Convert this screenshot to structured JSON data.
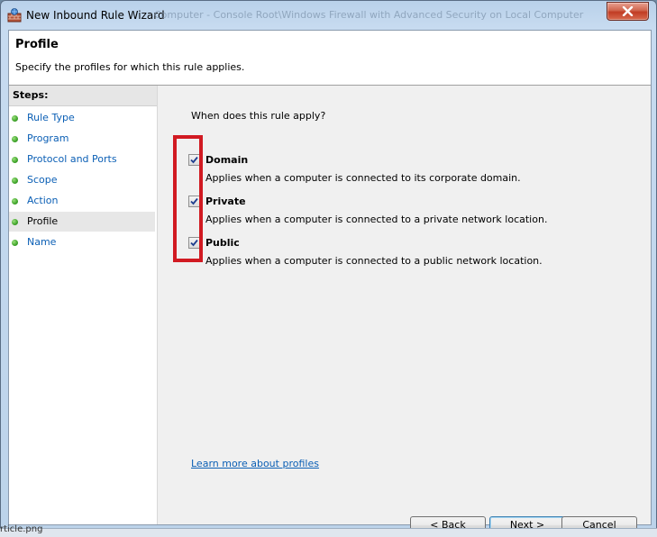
{
  "window": {
    "title": "New Inbound Rule Wizard",
    "background_title": "Computer - Console Root\\Windows Firewall with Advanced Security on Local Computer",
    "close_label": "X"
  },
  "header": {
    "title": "Profile",
    "subtitle": "Specify the profiles for which this rule applies."
  },
  "steps": {
    "title": "Steps:",
    "items": [
      {
        "label": "Rule Type",
        "active": false
      },
      {
        "label": "Program",
        "active": false
      },
      {
        "label": "Protocol and Ports",
        "active": false
      },
      {
        "label": "Scope",
        "active": false
      },
      {
        "label": "Action",
        "active": false
      },
      {
        "label": "Profile",
        "active": true
      },
      {
        "label": "Name",
        "active": false
      }
    ]
  },
  "main": {
    "question": "When does this rule apply?",
    "options": [
      {
        "title": "Domain",
        "description": "Applies when a computer is connected to its corporate domain.",
        "checked": true
      },
      {
        "title": "Private",
        "description": "Applies when a computer is connected to a private network location.",
        "checked": true
      },
      {
        "title": "Public",
        "description": "Applies when a computer is connected to a public network location.",
        "checked": true
      }
    ],
    "learn_more": "Learn more about profiles"
  },
  "buttons": {
    "back": "< Back",
    "next": "Next >",
    "cancel": "Cancel"
  },
  "taskbar": {
    "text": "rticle.png"
  },
  "colors": {
    "accent_link": "#0b5fb5",
    "highlight": "#d11a22",
    "close_button": "#c13c24"
  }
}
